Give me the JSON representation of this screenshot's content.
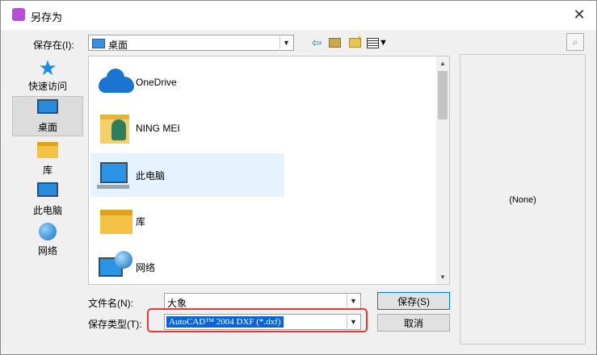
{
  "window": {
    "title": "另存为",
    "close_label": "✕"
  },
  "toolbar": {
    "save_in_label": "保存在(I):",
    "save_in_value": "桌面",
    "back_icon": "back-arrow-icon",
    "up_icon": "up-folder-icon",
    "new_folder_icon": "new-folder-icon",
    "view_icon": "view-menu-icon"
  },
  "places": [
    {
      "label": "快速访问",
      "icon": "star-icon"
    },
    {
      "label": "桌面",
      "icon": "desktop-icon",
      "selected": true
    },
    {
      "label": "库",
      "icon": "library-icon"
    },
    {
      "label": "此电脑",
      "icon": "computer-icon"
    },
    {
      "label": "网络",
      "icon": "network-icon"
    }
  ],
  "files": [
    {
      "name": "OneDrive",
      "icon": "onedrive-icon"
    },
    {
      "name": "NING MEI",
      "icon": "user-folder-icon"
    },
    {
      "name": "此电脑",
      "icon": "computer-icon",
      "selected": true
    },
    {
      "name": "库",
      "icon": "library-icon"
    },
    {
      "name": "网络",
      "icon": "network-icon"
    }
  ],
  "preview": {
    "text": "(None)"
  },
  "form": {
    "filename_label": "文件名(N):",
    "filename_value": "大象",
    "filetype_label": "保存类型(T):",
    "filetype_value": "AutoCAD™ 2004 DXF (*.dxf)"
  },
  "buttons": {
    "save": "保存(S)",
    "cancel": "取消"
  },
  "colors": {
    "highlight": "#e53935",
    "selection": "#0a64d8",
    "accent": "#1b75d0"
  }
}
